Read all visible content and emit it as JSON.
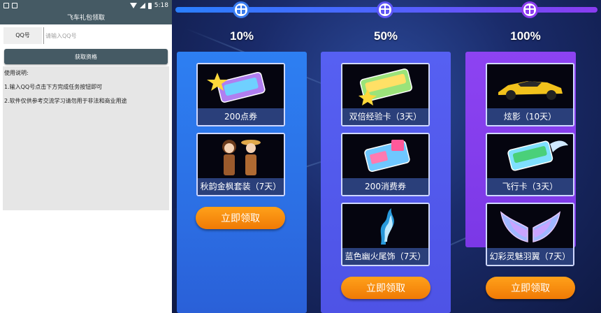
{
  "phone": {
    "status_time": "5:18",
    "title": "飞车礼包领取",
    "qq_label": "QQ号",
    "qq_value": "",
    "qq_placeholder": "请输入QQ号",
    "get_button": "获取资格",
    "instructions": [
      "使用说明:",
      "1.输入QQ号点击下方完成任务按钮即可",
      "2.软件仅供参考交流学习请勿用于非法和商业用途"
    ],
    "colors": {
      "bar": "#455a64",
      "panel": "#e6e6e6"
    }
  },
  "promo": {
    "progress_labels": [
      "10%",
      "50%",
      "100%"
    ],
    "columns": [
      {
        "items": [
          "200点券",
          "秋韵金枫套装（7天）"
        ],
        "claim_label": "立即领取"
      },
      {
        "items": [
          "双倍经验卡（3天）",
          "200消费券",
          "蓝色幽火尾饰（7天）"
        ],
        "claim_label": "立即领取"
      },
      {
        "items": [
          "炫影（10天）",
          "飞行卡（3天）",
          "幻彩灵魅羽翼（7天）"
        ],
        "claim_label": "立即领取"
      }
    ],
    "icons": [
      "gift-icon",
      "coupon-card-icon",
      "couple-outfit-icon",
      "double-exp-card-icon",
      "consume-coupon-icon",
      "blue-flame-tail-icon",
      "race-car-icon",
      "flight-card-icon",
      "rainbow-wings-icon"
    ],
    "colors": {
      "col1": "#2d7ff2",
      "col2": "#5660f2",
      "col3": "#8d43f2",
      "button": "#f58a0c"
    }
  }
}
